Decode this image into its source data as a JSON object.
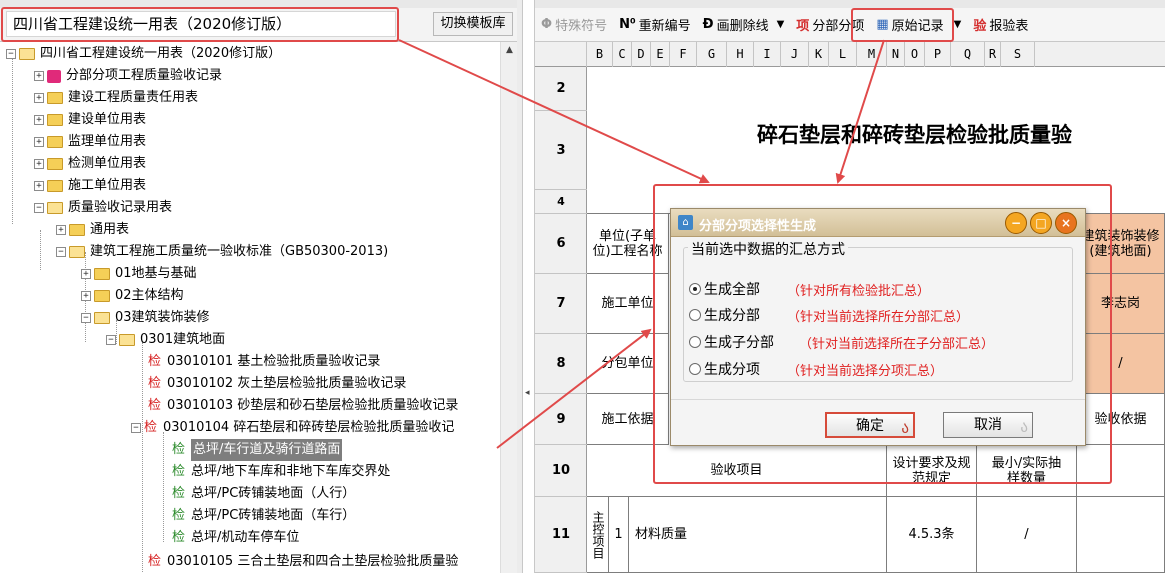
{
  "template": {
    "title": "四川省工程建设统一用表（2020修订版）",
    "switch_label": "切换模板库"
  },
  "tree": {
    "items": [
      {
        "label": "四川省工程建设统一用表（2020修订版）"
      },
      {
        "label": "分部分项工程质量验收记录"
      },
      {
        "label": "建设工程质量责任用表"
      },
      {
        "label": "建设单位用表"
      },
      {
        "label": "监理单位用表"
      },
      {
        "label": "检测单位用表"
      },
      {
        "label": "施工单位用表"
      },
      {
        "label": "质量验收记录用表"
      },
      {
        "label": "通用表"
      },
      {
        "label": "建筑工程施工质量统一验收标准（GB50300-2013)"
      },
      {
        "label": "01地基与基础"
      },
      {
        "label": "02主体结构"
      },
      {
        "label": "03建筑装饰装修"
      },
      {
        "label": "0301建筑地面"
      },
      {
        "label": "03010101 基土检验批质量验收记录"
      },
      {
        "label": "03010102 灰土垫层检验批质量验收记录"
      },
      {
        "label": "03010103 砂垫层和砂石垫层检验批质量验收记录"
      },
      {
        "label": "03010104 碎石垫层和碎砖垫层检验批质量验收记"
      },
      {
        "label": "总坪/车行道及骑行道路面"
      },
      {
        "label": "总坪/地下车库和非地下车库交界处"
      },
      {
        "label": "总坪/PC砖铺装地面（人行）"
      },
      {
        "label": "总坪/PC砖铺装地面（车行）"
      },
      {
        "label": "总坪/机动车停车位"
      },
      {
        "label": "03010105 三合土垫层和四合土垫层检验批质量验"
      }
    ],
    "check_glyph": "检"
  },
  "toolbar": {
    "special_char": "特殊符号",
    "renumber": "重新编号",
    "strike": "画删除线",
    "split_item": "分部分项",
    "original": "原始记录",
    "report": "报验表"
  },
  "sheet": {
    "columns": [
      "B",
      "C",
      "D",
      "E",
      "F",
      "G",
      "H",
      "I",
      "J",
      "K",
      "L",
      "M",
      "N",
      "O",
      "P",
      "Q",
      "R",
      "S"
    ],
    "rows": [
      "2",
      "3",
      "4",
      "6",
      "7",
      "8",
      "9",
      "10",
      "11"
    ],
    "title": "碎石垫层和碎砖垫层检验批质量验",
    "unit_label": "单位(子单位)工程名称",
    "right_header": "建筑装饰装修(建筑地面)",
    "constructor_label": "施工单位",
    "person": "李志岗",
    "subcontract_label": "分包单位",
    "slash": "/",
    "basis_label": "施工依据",
    "acceptance_basis": "验收依据",
    "accept_item": "验收项目",
    "design_req": "设计要求及规范规定",
    "min_sample": "最小/实际抽样数量",
    "main_control": "主控项目",
    "item_no": "1",
    "material": "材料质量",
    "clause": "4.5.3条"
  },
  "dialog": {
    "title": "分部分项选择性生成",
    "group_label": "当前选中数据的汇总方式",
    "options": [
      {
        "label": "生成全部",
        "note": "（针对所有检验批汇总）",
        "selected": true
      },
      {
        "label": "生成分部",
        "note": "（针对当前选择所在分部汇总）",
        "selected": false
      },
      {
        "label": "生成子分部",
        "note": "（针对当前选择所在子分部汇总）",
        "selected": false
      },
      {
        "label": "生成分项",
        "note": "（针对当前选择分项汇总）",
        "selected": false
      }
    ],
    "ok_label": "确定",
    "cancel_label": "取消"
  },
  "colors": {
    "highlight_red": "#e04a4a",
    "note_red": "#e02020",
    "salmon": "#f4c4a2"
  }
}
